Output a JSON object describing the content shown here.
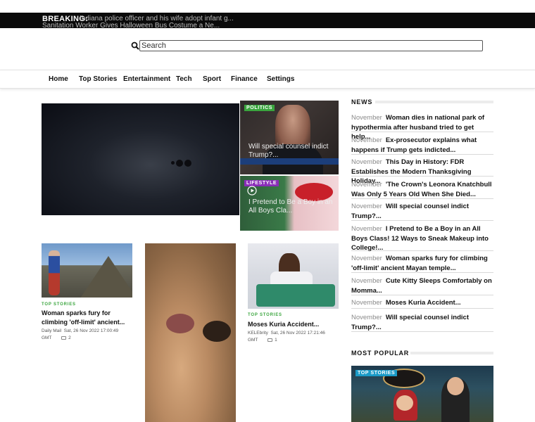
{
  "breaking": {
    "label": "BREAKING:",
    "ticker_1": "Indiana police officer and his wife adopt infant g...",
    "ticker_2": "Sanitation Worker Gives Halloween Bus Costume a Ne..."
  },
  "search": {
    "placeholder": "Search"
  },
  "nav": {
    "items": [
      {
        "label": "Home"
      },
      {
        "label": "Top Stories"
      },
      {
        "label": "Entertainment"
      },
      {
        "label": "Tech"
      },
      {
        "label": "Sport"
      },
      {
        "label": "Finance"
      },
      {
        "label": "Settings"
      }
    ]
  },
  "featured": {
    "politics": {
      "badge": "POLITICS",
      "title": "Will special counsel indict Trump?...",
      "badge_color": "#3aa53e"
    },
    "lifestyle": {
      "badge": "LIFESTYLE",
      "title": "I Pretend to Be a Boy in an All Boys Cla...",
      "badge_color": "#8a2db8"
    }
  },
  "stories": [
    {
      "tag": "TOP STORIES",
      "title": "Woman sparks fury for climbing 'off-limit' ancient...",
      "source": "Daily Mail",
      "date": "Sat, 26 Nov 2022 17:00:49 GMT",
      "comments": "2"
    },
    {
      "tag": "TOP STORIES",
      "title": "Moses Kuria Accident...",
      "source": "KELEbrity",
      "date": "Sat, 26 Nov 2022 17:21:46 GMT",
      "comments": "1"
    }
  ],
  "news": {
    "heading": "NEWS",
    "items": [
      {
        "month": "November",
        "title": "Woman dies in national park of hypothermia after husband tried to get help..."
      },
      {
        "month": "November",
        "title": "Ex-prosecutor explains what happens if Trump gets indicted..."
      },
      {
        "month": "November",
        "title": "This Day in History: FDR Establishes the Modern Thanksgiving Holiday..."
      },
      {
        "month": "November",
        "title": "'The Crown's Leonora Knatchbull Was Only 5 Years Old When She Died..."
      },
      {
        "month": "November",
        "title": "Will special counsel indict Trump?..."
      },
      {
        "month": "November",
        "title": "I Pretend to Be a Boy in an All Boys Class! 12 Ways to Sneak Makeup into College!..."
      },
      {
        "month": "November",
        "title": "Woman sparks fury for climbing 'off-limit' ancient Mayan temple..."
      },
      {
        "month": "November",
        "title": "Cute Kitty Sleeps Comfortably on Momma..."
      },
      {
        "month": "November",
        "title": "Moses Kuria Accident..."
      },
      {
        "month": "November",
        "title": "Will special counsel indict Trump?..."
      }
    ]
  },
  "most_popular": {
    "heading": "MOST POPULAR",
    "badge": "TOP STORIES"
  },
  "colors": {
    "tag_green": "#3aa53e",
    "breaking_bg": "#0b0b0b",
    "popular_badge": "#1a9ac7"
  }
}
